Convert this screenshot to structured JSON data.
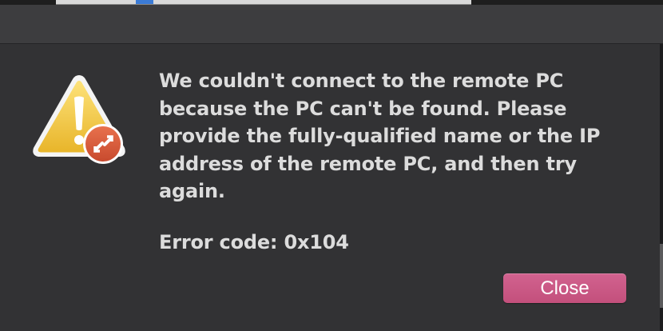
{
  "alert": {
    "icon": "warning-triangle-with-remote-desktop-badge-icon",
    "message": "We couldn't connect to the remote PC because the PC can't be found. Please provide the fully-qualified name or the IP address of the remote PC, and then try again.",
    "error_code": "Error code: 0x104",
    "close_label": "Close"
  },
  "colors": {
    "sheet_background": "#323234",
    "text": "#dcdcdc",
    "close_button": "#c95884",
    "warning_yellow": "#f2c83a",
    "badge_red": "#d9573a"
  }
}
